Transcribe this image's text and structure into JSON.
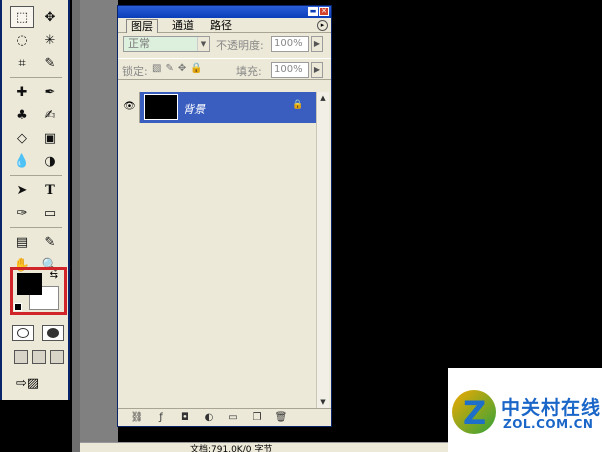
{
  "panel": {
    "tabs": [
      {
        "label": "图层"
      },
      {
        "label": "通道"
      },
      {
        "label": "路径"
      }
    ],
    "blend_mode": "正常",
    "opacity_label": "不透明度:",
    "opacity_value": "100%",
    "lock_label": "锁定:",
    "fill_label": "填充:",
    "fill_value": "100%",
    "layers": [
      {
        "name": "背景"
      }
    ]
  },
  "statusbar": {
    "text": "文档:791.0K/0 字节"
  },
  "watermark": {
    "cn": "中关村在线",
    "en": "ZOL.COM.CN"
  },
  "colors": {
    "foreground": "#000000",
    "background": "#FFFFFF",
    "selection": "#3A5EC0",
    "highlight_frame": "#D0262A"
  }
}
